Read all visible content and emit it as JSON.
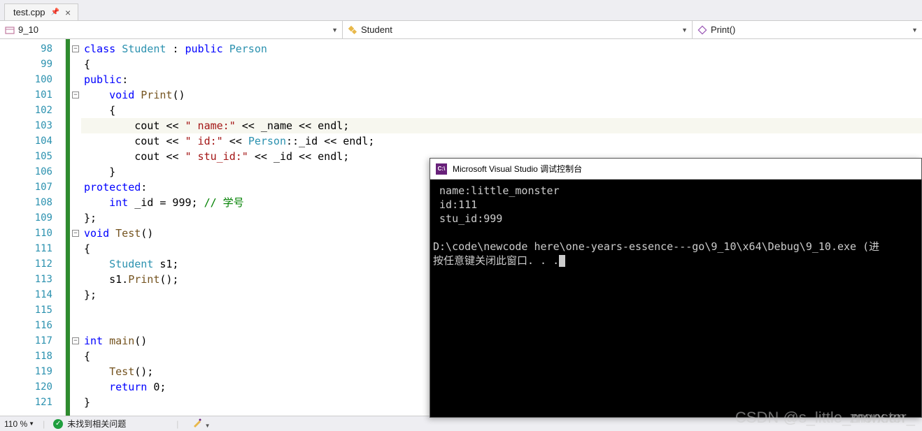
{
  "tab": {
    "filename": "test.cpp"
  },
  "dropdowns": {
    "scope": "9_10",
    "class": "Student",
    "member": "Print()"
  },
  "lines": [
    {
      "num": 98,
      "fold": "minus",
      "html": "<span class='kw'>class</span> <span class='type'>Student</span> : <span class='kw'>public</span> <span class='type'>Person</span>"
    },
    {
      "num": 99,
      "html": "{"
    },
    {
      "num": 100,
      "html": "<span class='kw'>public</span>:"
    },
    {
      "num": 101,
      "fold": "minus",
      "html": "    <span class='kw'>void</span> <span class='func'>Print</span>()"
    },
    {
      "num": 102,
      "html": "    {"
    },
    {
      "num": 103,
      "current": true,
      "html": "        cout &lt;&lt; <span class='str'>\" name:\"</span> &lt;&lt; _name &lt;&lt; endl;"
    },
    {
      "num": 104,
      "html": "        cout &lt;&lt; <span class='str'>\" id:\"</span> &lt;&lt; <span class='type'>Person</span>::_id &lt;&lt; endl;"
    },
    {
      "num": 105,
      "html": "        cout &lt;&lt; <span class='str'>\" stu_id:\"</span> &lt;&lt; _id &lt;&lt; endl;"
    },
    {
      "num": 106,
      "html": "    }"
    },
    {
      "num": 107,
      "html": "<span class='kw'>protected</span>:"
    },
    {
      "num": 108,
      "html": "    <span class='kw'>int</span> _id = 999; <span class='comm'>// 学号</span>"
    },
    {
      "num": 109,
      "html": "};"
    },
    {
      "num": 110,
      "fold": "minus",
      "html": "<span class='kw'>void</span> <span class='func'>Test</span>()"
    },
    {
      "num": 111,
      "html": "{"
    },
    {
      "num": 112,
      "html": "    <span class='type'>Student</span> s1;"
    },
    {
      "num": 113,
      "html": "    s1.<span class='func'>Print</span>();"
    },
    {
      "num": 114,
      "html": "};"
    },
    {
      "num": 115,
      "html": ""
    },
    {
      "num": 116,
      "html": ""
    },
    {
      "num": 117,
      "fold": "minus",
      "html": "<span class='kw'>int</span> <span class='func'>main</span>()"
    },
    {
      "num": 118,
      "html": "{"
    },
    {
      "num": 119,
      "html": "    <span class='func'>Test</span>();"
    },
    {
      "num": 120,
      "html": "    <span class='kw'>return</span> 0;"
    },
    {
      "num": 121,
      "html": "}"
    }
  ],
  "status": {
    "zoom": "110 %",
    "issues": "未找到相关问题"
  },
  "console": {
    "title": "Microsoft Visual Studio 调试控制台",
    "lines": [
      " name:little_monster",
      " id:111",
      " stu_id:999",
      "",
      "D:\\code\\newcode here\\one-years-essence---go\\9_10\\x64\\Debug\\9_10.exe (进",
      "按任意键关闭此窗口. . ."
    ]
  },
  "watermark": "CSDN @s_little_monster_",
  "watermark2": "znwx.cn"
}
